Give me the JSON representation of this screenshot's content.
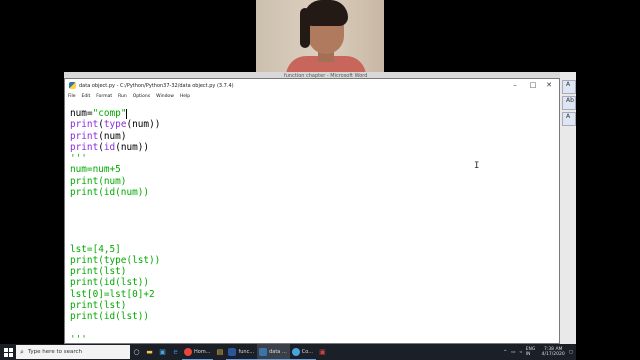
{
  "background_window": {
    "title": "function chapter - Microsoft Word"
  },
  "right_strip": {
    "labels": [
      "A",
      "Ab",
      "A"
    ]
  },
  "idle_window": {
    "title": "data object.py - C:/Python/Python37-32/data object.py (3.7.4)",
    "controls": {
      "minimize": "–",
      "maximize": "□",
      "close": "✕"
    },
    "menu": [
      "File",
      "Edit",
      "Format",
      "Run",
      "Options",
      "Window",
      "Help"
    ]
  },
  "code_lines": [
    [
      "num=\"comp\""
    ],
    [
      "print(type(num))"
    ],
    [
      "print(num)"
    ],
    [
      "print(id(num))"
    ],
    [
      "'''"
    ],
    [
      "num=num+5"
    ],
    [
      "print(num)"
    ],
    [
      "print(id(num))"
    ],
    [
      ""
    ],
    [
      ""
    ],
    [
      ""
    ],
    [
      ""
    ],
    [
      "lst=[4,5]"
    ],
    [
      "print(type(lst))"
    ],
    [
      "print(lst)"
    ],
    [
      "print(id(lst))"
    ],
    [
      "lst[0]=lst[0]+2"
    ],
    [
      "print(lst)"
    ],
    [
      "print(id(lst))"
    ],
    [
      ""
    ],
    [
      "'''"
    ]
  ],
  "taskbar": {
    "search_placeholder": "Type here to search",
    "apps": [
      {
        "label": "Hom...",
        "color": "#e8453c"
      },
      {
        "label": "func...",
        "color": "#2b579a"
      },
      {
        "label": "data ...",
        "color": "#3776ab"
      },
      {
        "label": "Co...",
        "color": "#4aa3df"
      }
    ],
    "tray": {
      "lang": "ENG IN",
      "time": "7:38 AM",
      "date": "4/17/2020"
    }
  }
}
